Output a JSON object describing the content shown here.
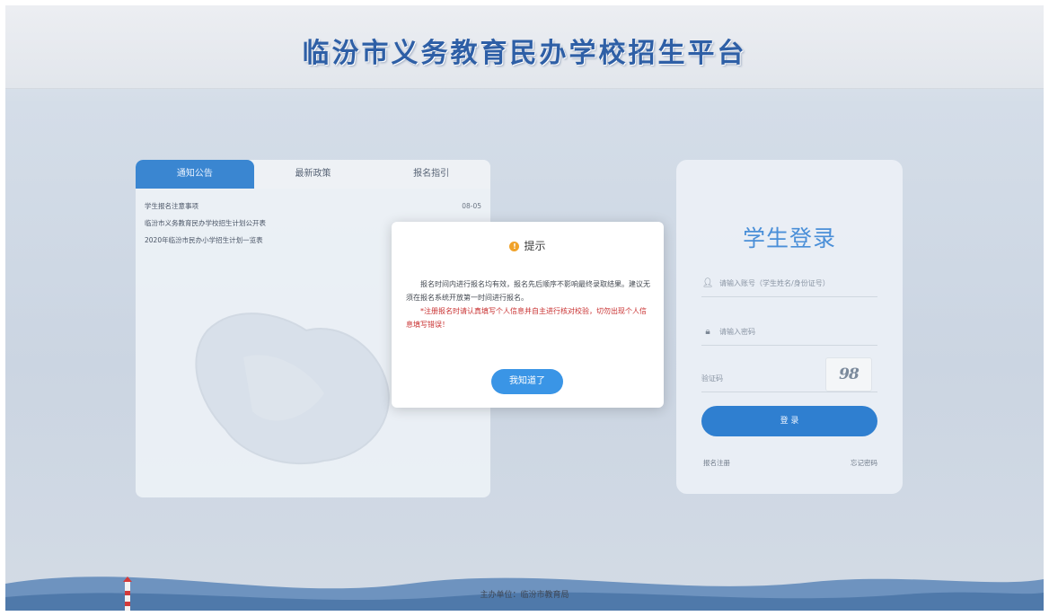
{
  "header": {
    "title": "临汾市义务教育民办学校招生平台"
  },
  "info_panel": {
    "tabs": [
      {
        "label": "通知公告"
      },
      {
        "label": "最新政策"
      },
      {
        "label": "报名指引"
      }
    ],
    "news": [
      {
        "title": "学生报名注意事项",
        "date": "08-05"
      },
      {
        "title": "临汾市义务教育民办学校招生计划公开表",
        "date": ""
      },
      {
        "title": "2020年临汾市民办小学招生计划一览表",
        "date": ""
      }
    ]
  },
  "login": {
    "title": "学生登录",
    "account_placeholder": "请输入账号（学生姓名/身份证号）",
    "password_placeholder": "请输入密码",
    "captcha_placeholder": "验证码",
    "captcha_text": "98",
    "submit_label": "登 录",
    "left_link": "报名注册",
    "right_link": "忘记密码"
  },
  "dialog": {
    "title": "提示",
    "paragraph1": "报名时间内进行报名均有效，报名先后顺序不影响最终录取结果。建议无须在报名系统开放第一时间进行报名。",
    "paragraph2": "*注册报名时请认真填写个人信息并自主进行核对校验，切勿出现个人信息填写错误！",
    "button_label": "我知道了"
  },
  "footer": {
    "text": "主办单位：临汾市教育局"
  },
  "colors": {
    "title_blue": "#2e5fa6",
    "accent_blue": "#3a86d1",
    "warning_red": "#c93232",
    "warning_icon": "#f0a22a"
  }
}
